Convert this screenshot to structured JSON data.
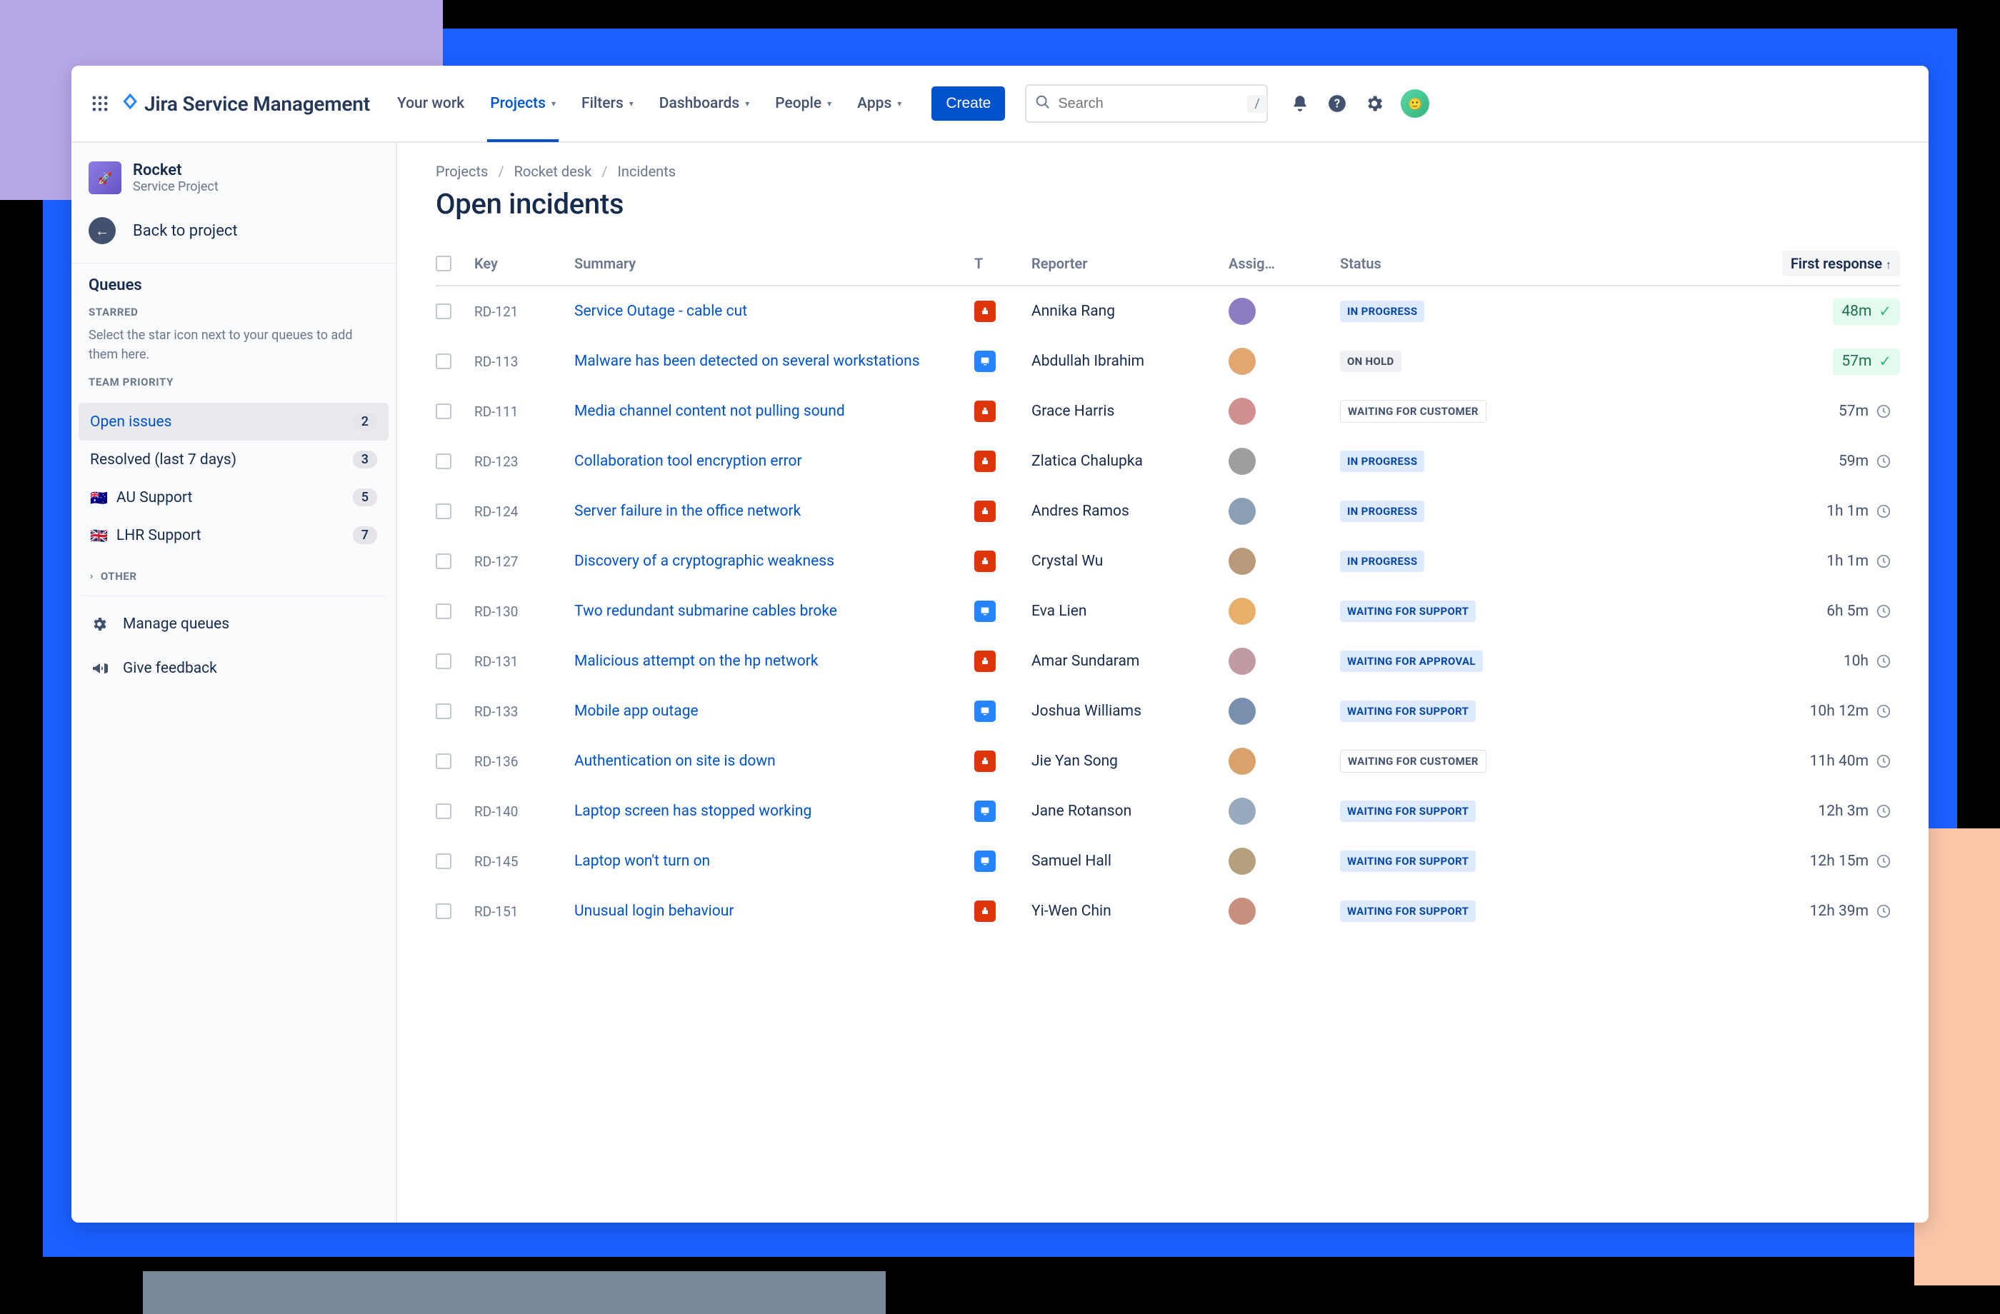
{
  "app": {
    "name": "Jira Service Management"
  },
  "nav": {
    "your_work": "Your work",
    "projects": "Projects",
    "filters": "Filters",
    "dashboards": "Dashboards",
    "people": "People",
    "apps": "Apps",
    "create": "Create"
  },
  "search": {
    "placeholder": "Search",
    "shortcut": "/"
  },
  "project": {
    "name": "Rocket",
    "subtitle": "Service Project",
    "back": "Back to project"
  },
  "sidebar": {
    "queues_heading": "Queues",
    "starred_heading": "STARRED",
    "starred_desc": "Select the star icon next to your queues to add them here.",
    "team_priority_heading": "TEAM PRIORITY",
    "other_heading": "OTHER",
    "manage": "Manage queues",
    "feedback": "Give feedback",
    "items": [
      {
        "label": "Open issues",
        "count": "2",
        "selected": true
      },
      {
        "label": "Resolved (last 7 days)",
        "count": "3"
      },
      {
        "label": "AU Support",
        "count": "5",
        "flag": "🇦🇺"
      },
      {
        "label": "LHR Support",
        "count": "7",
        "flag": "🇬🇧"
      }
    ]
  },
  "breadcrumb": {
    "a": "Projects",
    "b": "Rocket desk",
    "c": "Incidents"
  },
  "page_title": "Open incidents",
  "table": {
    "headers": {
      "key": "Key",
      "summary": "Summary",
      "t": "T",
      "reporter": "Reporter",
      "assignee": "Assig…",
      "status": "Status",
      "first_response": "First response"
    },
    "rows": [
      {
        "key": "RD-121",
        "summary": "Service Outage - cable cut",
        "type": "red",
        "reporter": "Annika Rang",
        "status": "IN PROGRESS",
        "status_class": "st-inprogress",
        "first": "48m",
        "first_style": "ok"
      },
      {
        "key": "RD-113",
        "summary": "Malware has been detected on several workstations",
        "type": "blue",
        "reporter": "Abdullah Ibrahim",
        "status": "ON HOLD",
        "status_class": "st-onhold",
        "first": "57m",
        "first_style": "ok"
      },
      {
        "key": "RD-111",
        "summary": "Media channel content not pulling sound",
        "type": "red",
        "reporter": "Grace Harris",
        "status": "WAITING FOR CUSTOMER",
        "status_class": "st-waitcust",
        "first": "57m",
        "first_style": "clock"
      },
      {
        "key": "RD-123",
        "summary": "Collaboration tool encryption error",
        "type": "red",
        "reporter": "Zlatica Chalupka",
        "status": "IN PROGRESS",
        "status_class": "st-inprogress",
        "first": "59m",
        "first_style": "clock"
      },
      {
        "key": "RD-124",
        "summary": "Server failure in the office network",
        "type": "red",
        "reporter": "Andres Ramos",
        "status": "IN PROGRESS",
        "status_class": "st-inprogress",
        "first": "1h 1m",
        "first_style": "clock"
      },
      {
        "key": "RD-127",
        "summary": "Discovery of a cryptographic weakness",
        "type": "red",
        "reporter": "Crystal Wu",
        "status": "IN PROGRESS",
        "status_class": "st-inprogress",
        "first": "1h 1m",
        "first_style": "clock"
      },
      {
        "key": "RD-130",
        "summary": "Two redundant submarine cables broke",
        "type": "blue",
        "reporter": "Eva Lien",
        "status": "WAITING FOR SUPPORT",
        "status_class": "st-waitsupp",
        "first": "6h 5m",
        "first_style": "clock"
      },
      {
        "key": "RD-131",
        "summary": "Malicious attempt on the hp network",
        "type": "red",
        "reporter": "Amar Sundaram",
        "status": "WAITING FOR APPROVAL",
        "status_class": "st-waitappr",
        "first": "10h",
        "first_style": "clock"
      },
      {
        "key": "RD-133",
        "summary": "Mobile app outage",
        "type": "blue",
        "reporter": "Joshua Williams",
        "status": "WAITING FOR SUPPORT",
        "status_class": "st-waitsupp",
        "first": "10h 12m",
        "first_style": "clock"
      },
      {
        "key": "RD-136",
        "summary": "Authentication on site is down",
        "type": "red",
        "reporter": "Jie Yan Song",
        "status": "WAITING FOR CUSTOMER",
        "status_class": "st-waitcust",
        "first": "11h 40m",
        "first_style": "clock"
      },
      {
        "key": "RD-140",
        "summary": "Laptop screen has stopped working",
        "type": "blue",
        "reporter": "Jane Rotanson",
        "status": "WAITING FOR SUPPORT",
        "status_class": "st-waitsupp",
        "first": "12h 3m",
        "first_style": "clock"
      },
      {
        "key": "RD-145",
        "summary": "Laptop won't turn on",
        "type": "blue",
        "reporter": "Samuel Hall",
        "status": "WAITING FOR SUPPORT",
        "status_class": "st-waitsupp",
        "first": "12h 15m",
        "first_style": "clock"
      },
      {
        "key": "RD-151",
        "summary": "Unusual login behaviour",
        "type": "red",
        "reporter": "Yi-Wen Chin",
        "status": "WAITING FOR SUPPORT",
        "status_class": "st-waitsupp",
        "first": "12h 39m",
        "first_style": "clock"
      }
    ]
  }
}
